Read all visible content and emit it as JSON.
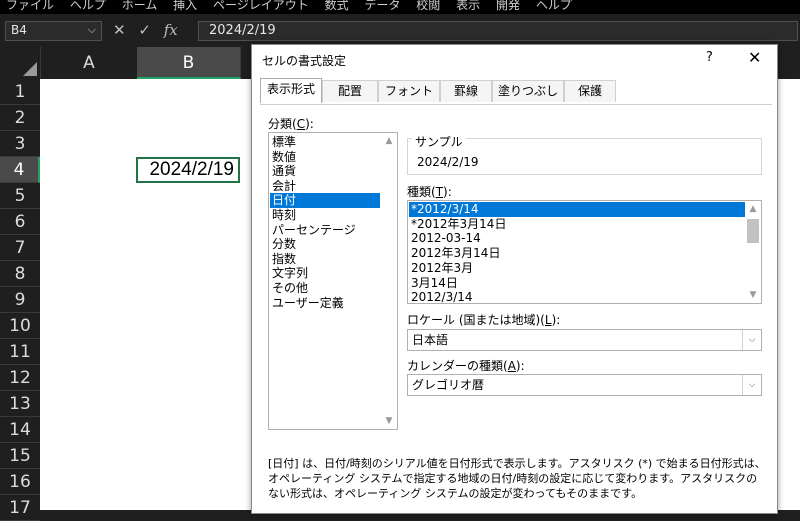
{
  "menubar": [
    "ファイル",
    "ヘルプ",
    "ホーム",
    "挿入",
    "ページレイアウト",
    "数式",
    "データ",
    "校閲",
    "表示",
    "開発",
    "ヘルプ"
  ],
  "formula_bar": {
    "name_box": "B4",
    "formula": "2024/2/19"
  },
  "columns": [
    "A",
    "B"
  ],
  "rows": [
    "1",
    "2",
    "3",
    "4",
    "5",
    "6",
    "7",
    "8",
    "9",
    "10",
    "11",
    "12",
    "13",
    "14",
    "15",
    "16",
    "17"
  ],
  "cell_b4": "2024/2/19",
  "dialog": {
    "title": "セルの書式設定",
    "help": "?",
    "close": "✕",
    "tabs": [
      "表示形式",
      "配置",
      "フォント",
      "罫線",
      "塗りつぶし",
      "保護"
    ],
    "category_label": "分類(",
    "category_key": "C",
    "category_close": "):",
    "categories": [
      "標準",
      "数値",
      "通貨",
      "会計",
      "日付",
      "時刻",
      "パーセンテージ",
      "分数",
      "指数",
      "文字列",
      "その他",
      "ユーザー定義"
    ],
    "selected_category": "日付",
    "sample_label": "サンプル",
    "sample_value": "2024/2/19",
    "type_label": "種類(",
    "type_key": "T",
    "type_close": "):",
    "types": [
      "*2012/3/14",
      "*2012年3月14日",
      "2012-03-14",
      "2012年3月14日",
      "2012年3月",
      "3月14日",
      "2012/3/14"
    ],
    "selected_type": "*2012/3/14",
    "locale_label": "ロケール (国または地域)(",
    "locale_key": "L",
    "locale_close": "):",
    "locale_value": "日本語",
    "calendar_label": "カレンダーの種類(",
    "calendar_key": "A",
    "calendar_close": "):",
    "calendar_value": "グレゴリオ暦",
    "description": "[日付] は、日付/時刻のシリアル値を日付形式で表示します。アスタリスク (*) で始まる日付形式は、オペレーティング システムで指定する地域の日付/時刻の設定に応じて変わります。アスタリスクのない形式は、オペレーティング システムの設定が変わってもそのままです。"
  },
  "icons": {
    "cancel": "✕",
    "enter": "✓",
    "function": "fx",
    "dropdown": "⌵",
    "scroll_up": "▲",
    "scroll_down": "▼"
  },
  "colors": {
    "excel_green": "#217346",
    "selection_blue": "#0078d7",
    "dark_bg": "#1f1f1f"
  }
}
